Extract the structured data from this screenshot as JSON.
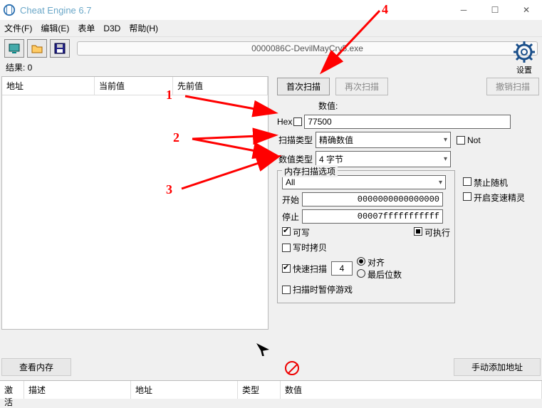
{
  "titlebar": {
    "title": "Cheat Engine 6.7"
  },
  "menu": {
    "file": "文件(F)",
    "edit": "编辑(E)",
    "table": "表单",
    "d3d": "D3D",
    "help": "帮助(H)"
  },
  "process": {
    "name": "0000086C-DevilMayCry5.exe"
  },
  "settingsLabel": "设置",
  "results": {
    "label": "结果: 0"
  },
  "leftTable": {
    "addr": "地址",
    "cur": "当前值",
    "prev": "先前值"
  },
  "scan": {
    "firstScan": "首次扫描",
    "nextScan": "再次扫描",
    "undoScan": "撤销扫描",
    "valueLabel": "数值:",
    "hexLabel": "Hex",
    "value": "77500",
    "scanTypeLabel": "扫描类型",
    "scanType": "精确数值",
    "valueTypeLabel": "数值类型",
    "valueType": "4 字节",
    "notLabel": "Not"
  },
  "mem": {
    "groupLabel": "内存扫描选项",
    "allOption": "All",
    "startLabel": "开始",
    "startValue": "0000000000000000",
    "stopLabel": "停止",
    "stopValue": "00007fffffffffff",
    "writable": "可写",
    "executable": "可执行",
    "copyOnWrite": "写时拷贝",
    "fastScan": "快速扫描",
    "fastScanVal": "4",
    "alignment": "对齐",
    "lastDigit": "最后位数",
    "pauseWhileScan": "扫描时暂停游戏"
  },
  "sideChk": {
    "noRandom": "禁止随机",
    "speedhack": "开启变速精灵"
  },
  "bottom": {
    "memoryView": "查看内存",
    "addAddress": "手动添加地址"
  },
  "cheatCols": {
    "active": "激活",
    "desc": "描述",
    "addr": "地址",
    "type": "类型",
    "value": "数值"
  },
  "annot": {
    "n1": "1",
    "n2": "2",
    "n3": "3",
    "n4": "4"
  }
}
